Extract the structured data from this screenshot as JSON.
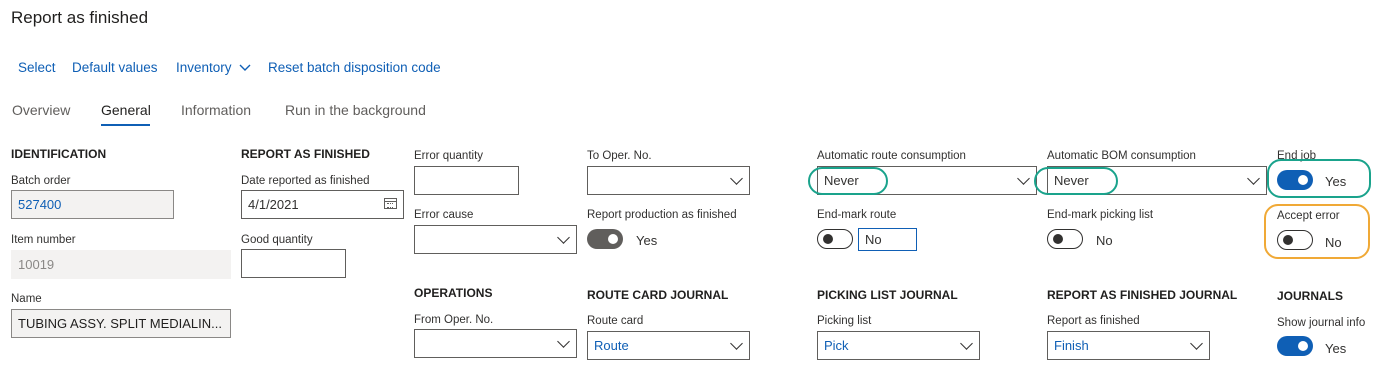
{
  "page": {
    "title": "Report as finished"
  },
  "actions": {
    "select": "Select",
    "default_values": "Default values",
    "inventory": "Inventory",
    "reset_batch": "Reset batch disposition code"
  },
  "tabs": {
    "overview": "Overview",
    "general": "General",
    "information": "Information",
    "background": "Run in the background"
  },
  "identification": {
    "heading": "IDENTIFICATION",
    "batch_order_label": "Batch order",
    "batch_order_value": "527400",
    "item_number_label": "Item number",
    "item_number_value": "10019",
    "name_label": "Name",
    "name_value": "TUBING ASSY. SPLIT MEDIALIN..."
  },
  "report_finished": {
    "heading": "REPORT AS FINISHED",
    "date_label": "Date reported as finished",
    "date_value": "4/1/2021",
    "good_qty_label": "Good quantity",
    "good_qty_value": ""
  },
  "errors": {
    "error_qty_label": "Error quantity",
    "error_qty_value": "",
    "error_cause_label": "Error cause",
    "error_cause_value": ""
  },
  "to_oper": {
    "label": "To Oper. No.",
    "value": "",
    "report_production_label": "Report production as finished",
    "report_production_value": "Yes"
  },
  "operations": {
    "heading": "OPERATIONS",
    "from_oper_label": "From Oper. No.",
    "from_oper_value": ""
  },
  "route_card_journal": {
    "heading": "ROUTE CARD JOURNAL",
    "route_card_label": "Route card",
    "route_card_value": "Route"
  },
  "route": {
    "auto_route_label": "Automatic route consumption",
    "auto_route_value": "Never",
    "end_mark_route_label": "End-mark route",
    "end_mark_route_value": "No"
  },
  "picking_list_journal": {
    "heading": "PICKING LIST JOURNAL",
    "picking_list_label": "Picking list",
    "picking_list_value": "Pick"
  },
  "bom": {
    "auto_bom_label": "Automatic BOM consumption",
    "auto_bom_value": "Never",
    "end_mark_picking_label": "End-mark picking list",
    "end_mark_picking_value": "No"
  },
  "report_finished_journal": {
    "heading": "REPORT AS FINISHED JOURNAL",
    "label": "Report as finished",
    "value": "Finish"
  },
  "end_job": {
    "label": "End job",
    "value": "Yes",
    "accept_error_label": "Accept error",
    "accept_error_value": "No"
  },
  "journals": {
    "heading": "JOURNALS",
    "show_info_label": "Show journal info",
    "show_info_value": "Yes"
  },
  "colors": {
    "accent": "#0f5fb5",
    "highlight_teal": "#1aa38c",
    "highlight_orange": "#f0a936"
  }
}
